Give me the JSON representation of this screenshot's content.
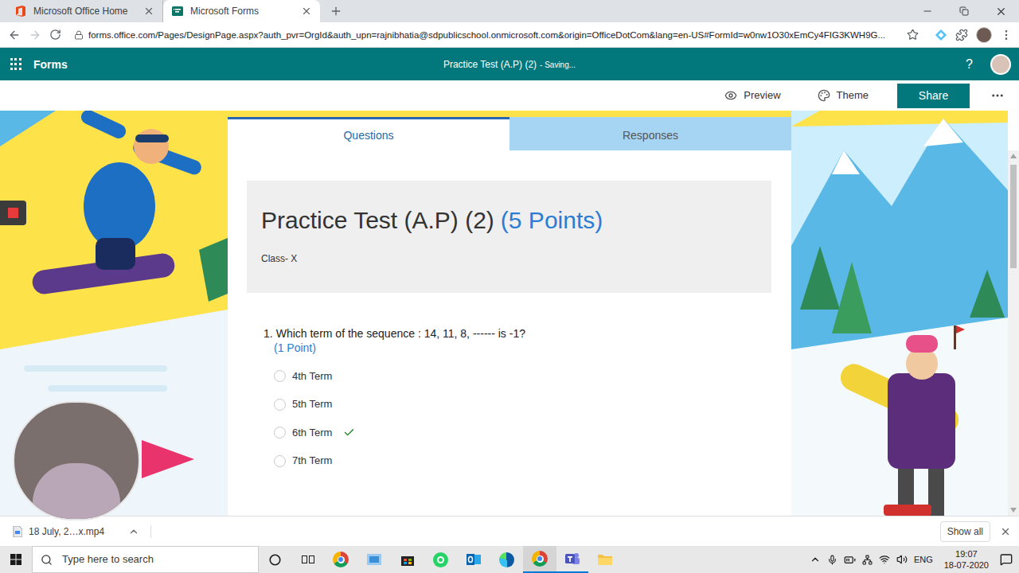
{
  "browser": {
    "tabs": [
      {
        "title": "Microsoft Office Home",
        "selected": false
      },
      {
        "title": "Microsoft Forms",
        "selected": true
      }
    ],
    "url": "forms.office.com/Pages/DesignPage.aspx?auth_pvr=OrgId&auth_upn=rajnibhatia@sdpublicschool.onmicrosoft.com&origin=OfficeDotCom&lang=en-US#FormId=w0nw1O30xEmCy4FIG3KWH9G..."
  },
  "app": {
    "name": "Forms",
    "form_title": "Practice Test (A.P) (2)",
    "status": "- Saving...",
    "help": "?"
  },
  "commands": [
    {
      "label": "Preview",
      "kind": "preview"
    },
    {
      "label": "Theme",
      "kind": "theme"
    }
  ],
  "share": "Share",
  "tabs": [
    {
      "label": "Questions",
      "selected": true
    },
    {
      "label": "Responses",
      "selected": false
    }
  ],
  "form": {
    "title": "Practice Test (A.P) (2)",
    "points": "(5 Points)",
    "description": "Class- X"
  },
  "questions": [
    {
      "number": "1.",
      "text": "Which term of the sequence : 14, 11, 8, ------ is -1?",
      "points": "(1 Point)",
      "options": [
        {
          "label": "4th Term",
          "selected": false,
          "correct": false
        },
        {
          "label": "5th Term",
          "selected": false,
          "correct": false
        },
        {
          "label": "6th Term",
          "selected": false,
          "correct": true
        },
        {
          "label": "7th Term",
          "selected": false,
          "correct": false
        }
      ]
    }
  ],
  "download": {
    "file": "18 July, 2…x.mp4",
    "show_all": "Show all"
  },
  "taskbar": {
    "search": "Type here to search",
    "language": "ENG",
    "time": "19:07",
    "date": "18-07-2020"
  }
}
